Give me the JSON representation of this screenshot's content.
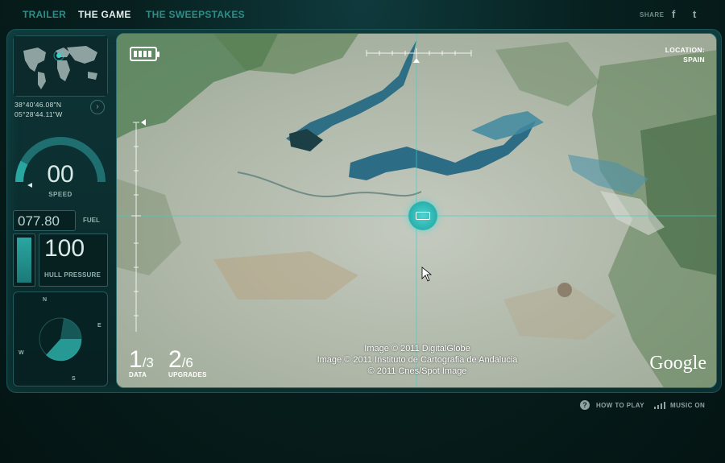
{
  "nav": {
    "trailer": "TRAILER",
    "game": "THE GAME",
    "sweepstakes": "THE SWEEPSTAKES",
    "share": "SHARE",
    "facebook": "f",
    "twitter": "t"
  },
  "sidebar": {
    "lat": "38°40'46.08\"N",
    "lon": "05°28'44.11\"W",
    "coord_button": "›",
    "speed_value": "00",
    "speed_label": "SPEED",
    "fuel_value": "077.80",
    "fuel_label": "FUEL",
    "hull_value": "100",
    "hull_label": "HULL PRESSURE",
    "compass": {
      "n": "",
      "e": "E",
      "w": "W",
      "s": "S",
      "nw": "N"
    }
  },
  "map": {
    "location_label": "LOCATION:",
    "location_value": "SPAIN",
    "data_collected": "1",
    "data_total": "/3",
    "data_label": "DATA",
    "upgrades_collected": "2",
    "upgrades_total": "/6",
    "upgrades_label": "UPGRADES",
    "credits": [
      "Image © 2011 DigitalGlobe",
      "Image © 2011 Instituto de Cartografia de Andalucia",
      "© 2011 Cnes/Spot Image"
    ],
    "google": "Google"
  },
  "footer": {
    "help_glyph": "?",
    "how_to_play": "HOW TO PLAY",
    "music": "MUSIC ON"
  },
  "colors": {
    "accent": "#2aa6a1",
    "background": "#07201f",
    "water": "#2f6f86"
  },
  "icons": [
    "battery-icon",
    "player-icon",
    "help-icon",
    "music-icon",
    "world-map-icon",
    "compass-icon"
  ]
}
